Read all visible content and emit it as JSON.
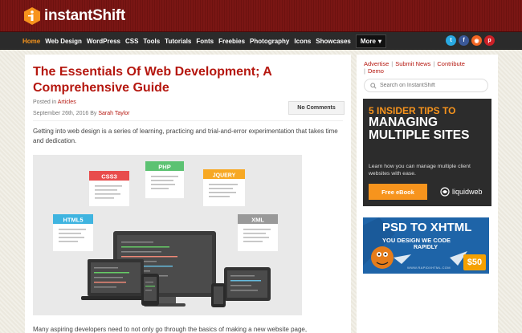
{
  "header": {
    "logo_text": "instantShift"
  },
  "nav": {
    "items": [
      "Home",
      "Web Design",
      "WordPress",
      "CSS",
      "Tools",
      "Tutorials",
      "Fonts",
      "Freebies",
      "Photography",
      "Icons",
      "Showcases"
    ],
    "more_label": "More",
    "active": "Home"
  },
  "social": [
    {
      "icon": "twitter-icon",
      "color": "#29a9e1"
    },
    {
      "icon": "facebook-icon",
      "color": "#3b5998"
    },
    {
      "icon": "rss-icon",
      "color": "#f26522"
    },
    {
      "icon": "pinterest-icon",
      "color": "#cb2027"
    }
  ],
  "article": {
    "title": "The Essentials Of Web Development; A Comprehensive Guide",
    "posted_prefix": "Posted in",
    "category": "Articles",
    "date": "September 26th, 2016 By",
    "author": "Sarah Taylor",
    "comments_label": "No Comments",
    "intro": "Getting into web design is a series of learning, practicing and trial-and-error experimentation that takes time and dedication.",
    "hero_labels": {
      "css": "CSS3",
      "php": "PHP",
      "jquery": "JQUERY",
      "html": "HTML5",
      "xml": "XML"
    },
    "next_text": "Many aspiring developers need to not only go through the basics of making a new website page,"
  },
  "sidebar": {
    "links": [
      "Advertise",
      "Submit News",
      "Contribute",
      "Demo"
    ],
    "search_placeholder": "Search on InstantShift",
    "ad1": {
      "headline1": "5 INSIDER TIPS TO",
      "headline2": "MANAGING MULTIPLE SITES",
      "sub": "Learn how you can manage multiple client websites with ease.",
      "button": "Free eBook",
      "brand": "liquidweb"
    },
    "ad2": {
      "headline": "PSD TO XHTML",
      "sub1": "YOU DESIGN WE CODE",
      "sub2": "RAPIDLY",
      "url": "WWW.RAPIDXHTML.COM",
      "price": "$50"
    }
  },
  "colors": {
    "brand_red": "#b5170f",
    "accent_orange": "#f7941d",
    "nav_bg": "#2b2b2b"
  }
}
